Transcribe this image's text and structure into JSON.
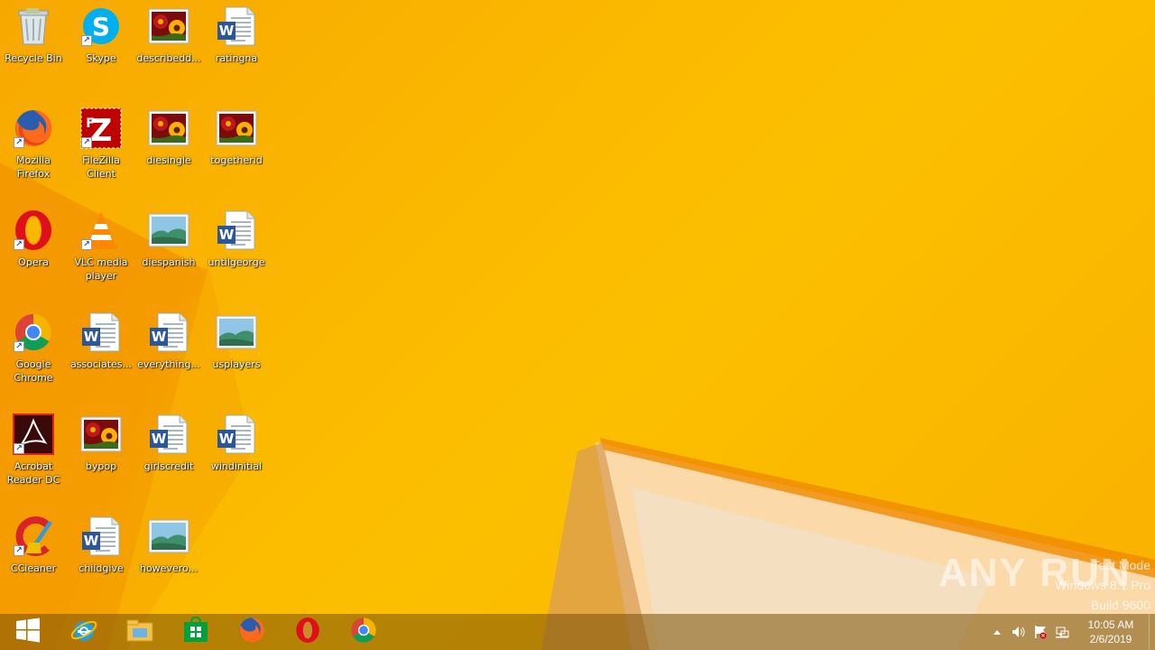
{
  "desktop": {
    "icons": [
      {
        "label": "Recycle Bin",
        "icon": "recycle-bin-icon",
        "shortcut": false
      },
      {
        "label": "Skype",
        "icon": "skype-icon",
        "shortcut": true
      },
      {
        "label": "describedd...",
        "icon": "image-file-icon",
        "shortcut": false
      },
      {
        "label": "ratingna",
        "icon": "word-document-icon",
        "shortcut": false
      },
      {
        "label": "Mozilla Firefox",
        "icon": "firefox-icon",
        "shortcut": true
      },
      {
        "label": "FileZilla Client",
        "icon": "filezilla-icon",
        "shortcut": true
      },
      {
        "label": "diesingle",
        "icon": "image-file-icon",
        "shortcut": false
      },
      {
        "label": "togetherid",
        "icon": "image-file-icon",
        "shortcut": false
      },
      {
        "label": "Opera",
        "icon": "opera-icon",
        "shortcut": true
      },
      {
        "label": "VLC media player",
        "icon": "vlc-icon",
        "shortcut": true
      },
      {
        "label": "diespanish",
        "icon": "landscape-image-icon",
        "shortcut": false
      },
      {
        "label": "untilgeorge",
        "icon": "word-document-icon",
        "shortcut": false
      },
      {
        "label": "Google Chrome",
        "icon": "chrome-icon",
        "shortcut": true
      },
      {
        "label": "associates...",
        "icon": "word-document-icon",
        "shortcut": false
      },
      {
        "label": "everything...",
        "icon": "word-document-icon",
        "shortcut": false
      },
      {
        "label": "usplayers",
        "icon": "landscape-image-icon",
        "shortcut": false
      },
      {
        "label": "Acrobat Reader DC",
        "icon": "acrobat-icon",
        "shortcut": true
      },
      {
        "label": "bypop",
        "icon": "image-file-icon",
        "shortcut": false
      },
      {
        "label": "girlscredit",
        "icon": "word-document-icon",
        "shortcut": false
      },
      {
        "label": "windinitial",
        "icon": "word-document-icon",
        "shortcut": false
      },
      {
        "label": "CCleaner",
        "icon": "ccleaner-icon",
        "shortcut": true
      },
      {
        "label": "childgive",
        "icon": "word-document-icon",
        "shortcut": false
      },
      {
        "label": "howevero...",
        "icon": "landscape-image-icon",
        "shortcut": false
      }
    ]
  },
  "taskbar": {
    "pinned": [
      {
        "name": "start-button",
        "icon": "windows-logo-icon"
      },
      {
        "name": "taskbar-internet-explorer",
        "icon": "internet-explorer-icon"
      },
      {
        "name": "taskbar-file-explorer",
        "icon": "file-explorer-icon"
      },
      {
        "name": "taskbar-store",
        "icon": "store-icon"
      },
      {
        "name": "taskbar-firefox",
        "icon": "firefox-icon"
      },
      {
        "name": "taskbar-opera",
        "icon": "opera-icon"
      },
      {
        "name": "taskbar-chrome",
        "icon": "chrome-icon"
      }
    ],
    "tray": {
      "icons": [
        "chevron-up-icon",
        "speaker-icon",
        "action-center-flag-icon",
        "network-icon"
      ],
      "time": "10:05 AM",
      "date": "2/6/2019"
    }
  },
  "watermark": {
    "line1": "Test Mode",
    "line2": "Windows 8.1 Pro",
    "line3": "Build 9600",
    "brand": "ANY RUN"
  }
}
